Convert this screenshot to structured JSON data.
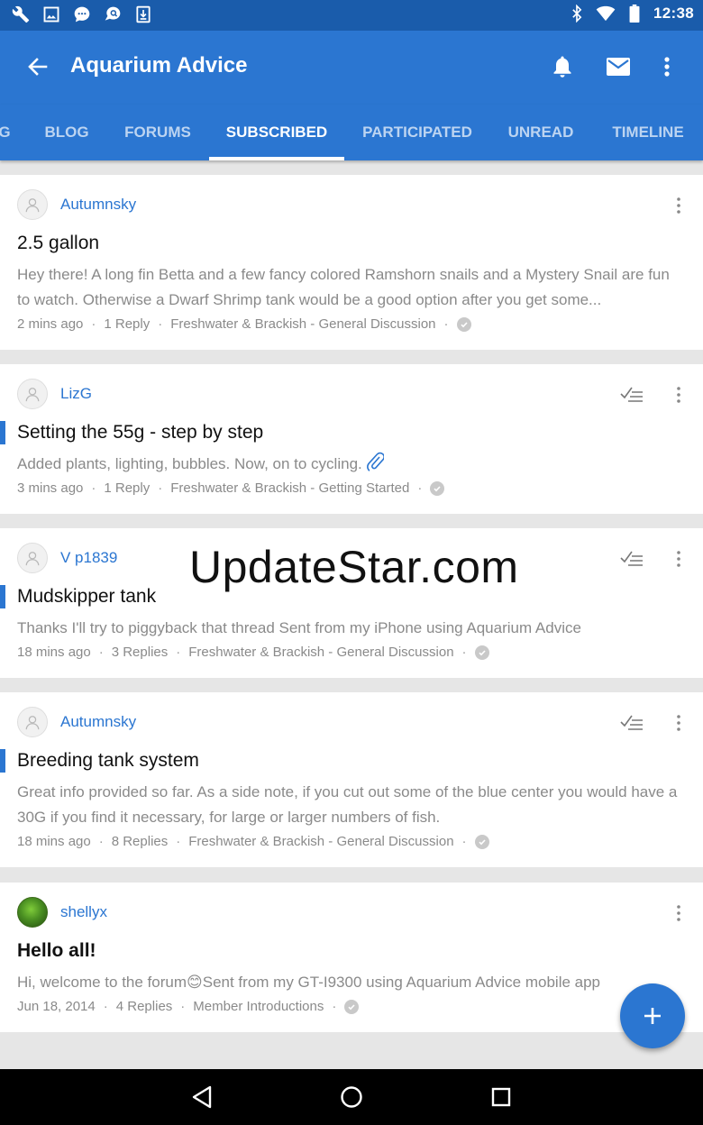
{
  "status_bar": {
    "time": "12:38",
    "left_icons": [
      "wrench-icon",
      "image-icon",
      "chat-bubble-icon",
      "chat-search-icon",
      "download-icon"
    ],
    "right_icons": [
      "bluetooth-icon",
      "wifi-icon",
      "battery-icon"
    ]
  },
  "app_bar": {
    "title": "Aquarium Advice",
    "actions": [
      "bell-icon",
      "mail-icon",
      "more-vert-icon"
    ]
  },
  "tabs": [
    {
      "label": "G"
    },
    {
      "label": "BLOG"
    },
    {
      "label": "FORUMS"
    },
    {
      "label": "SUBSCRIBED",
      "active": true
    },
    {
      "label": "PARTICIPATED"
    },
    {
      "label": "UNREAD"
    },
    {
      "label": "TIMELINE"
    }
  ],
  "threads": [
    {
      "author": "Autumnsky",
      "title": "2.5 gallon",
      "snippet": "Hey there! A long fin Betta and a few fancy colored Ramshorn snails and a Mystery Snail are fun to watch. Otherwise a Dwarf Shrimp tank would be a good option after you get some...",
      "time": "2 mins ago",
      "replies": "1 Reply",
      "forum": "Freshwater & Brackish - General Discussion",
      "unread": false,
      "watched_icon": false
    },
    {
      "author": "LizG",
      "title": "Setting the 55g - step by step",
      "snippet": "Added plants, lighting, bubbles. Now, on to cycling.",
      "time": "3 mins ago",
      "replies": "1 Reply",
      "forum": "Freshwater & Brackish - Getting Started",
      "unread": true,
      "watched_icon": true,
      "attachment": true
    },
    {
      "author": "V p1839",
      "title": "Mudskipper tank",
      "snippet": "Thanks I'll try to piggyback that thread Sent from my iPhone using Aquarium Advice",
      "time": "18 mins ago",
      "replies": "3 Replies",
      "forum": "Freshwater & Brackish - General Discussion",
      "unread": true,
      "watched_icon": true
    },
    {
      "author": "Autumnsky",
      "title": "Breeding tank system",
      "snippet": "Great info provided so far. As a side note, if you cut out some of the blue center you would have a 30G if you find it necessary, for large or larger numbers of fish.",
      "time": "18 mins ago",
      "replies": "8 Replies",
      "forum": "Freshwater & Brackish - General Discussion",
      "unread": true,
      "watched_icon": true
    },
    {
      "author": "shellyx",
      "title": "Hello all!",
      "snippet": "Hi, welcome to the forum😊Sent from my GT-I9300 using Aquarium Advice mobile app",
      "time": "Jun 18, 2014",
      "replies": "4 Replies",
      "forum": "Member Introductions",
      "unread": false,
      "watched_icon": false
    }
  ],
  "watermark": "UpdateStar.com",
  "fab_icon": "plus-icon",
  "nav_bar": [
    "back-triangle-icon",
    "home-circle-icon",
    "recents-square-icon"
  ],
  "colors": {
    "status_bar": "#1a5cab",
    "app_bar": "#2b76d1",
    "accent": "#2b76d1",
    "background": "#e6e6e6"
  }
}
